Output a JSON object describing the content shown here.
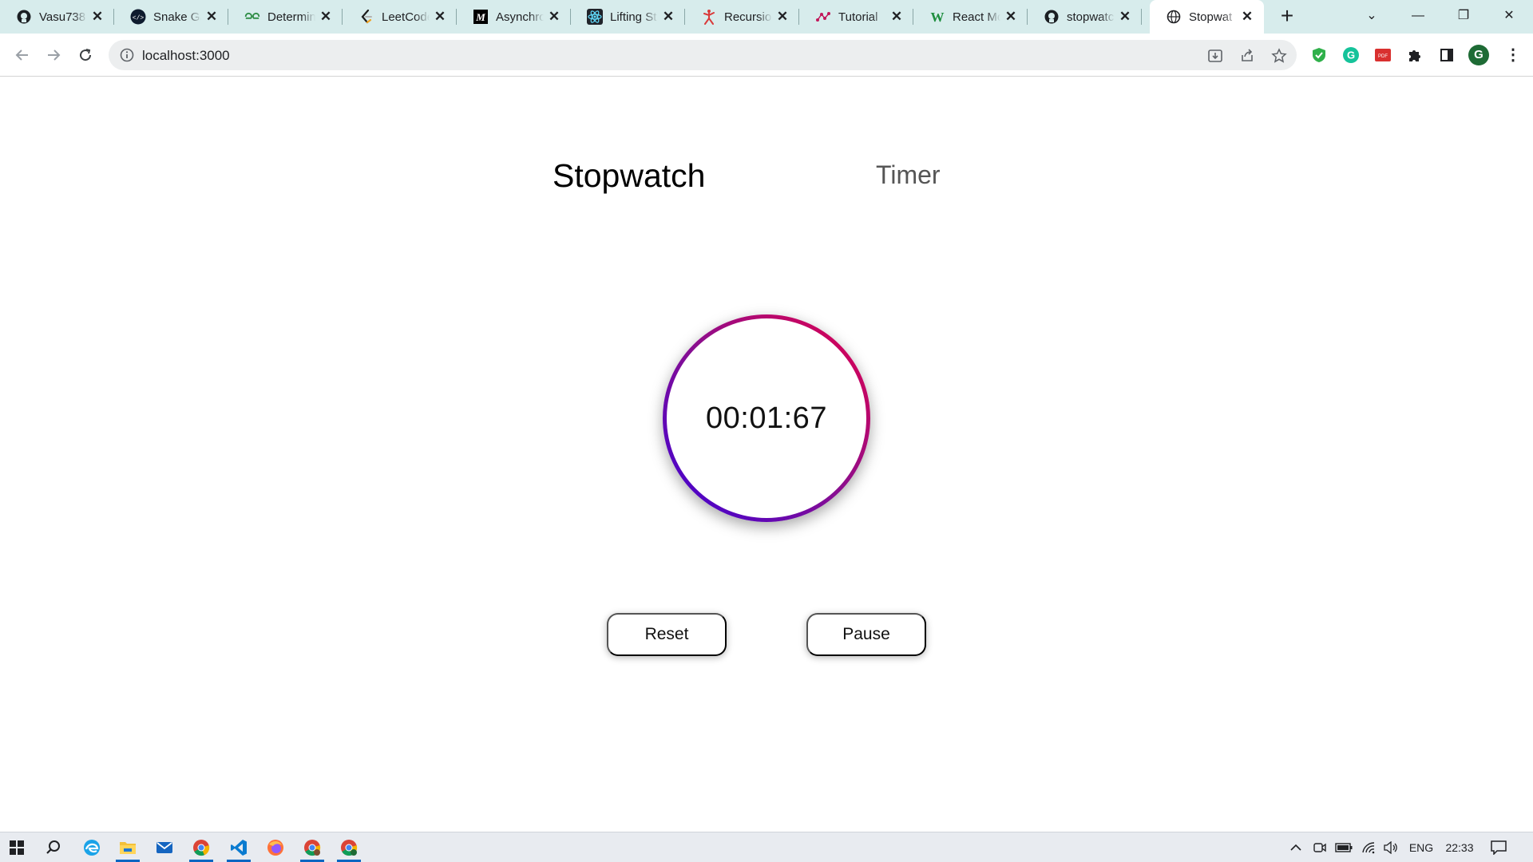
{
  "browser": {
    "tabs": [
      {
        "title": "Vasu738",
        "icon": "github-icon"
      },
      {
        "title": "Snake Ga",
        "icon": "code-icon"
      },
      {
        "title": "Determin",
        "icon": "geeksforgeeks-icon"
      },
      {
        "title": "LeetCode",
        "icon": "leetcode-icon"
      },
      {
        "title": "Asynchro",
        "icon": "medium-icon"
      },
      {
        "title": "Lifting St",
        "icon": "react-icon"
      },
      {
        "title": "Recursio",
        "icon": "person-icon"
      },
      {
        "title": "Tutorial",
        "icon": "dots-icon"
      },
      {
        "title": "React Mo",
        "icon": "w-icon"
      },
      {
        "title": "stopwatc",
        "icon": "github-icon"
      },
      {
        "title": "Stopwat",
        "icon": "globe-icon",
        "active": true
      }
    ],
    "address": "localhost:3000"
  },
  "app": {
    "modes": {
      "stopwatch": "Stopwatch",
      "timer": "Timer"
    },
    "display": "00:01:67",
    "ring_gradient": [
      "#e5004b",
      "#8a0e8f",
      "#3a00d8"
    ],
    "buttons": {
      "reset": "Reset",
      "pause": "Pause"
    }
  },
  "taskbar": {
    "apps": [
      "windows-start-icon",
      "search-icon",
      "edge-icon",
      "file-explorer-icon",
      "mail-icon",
      "chrome-icon",
      "vscode-icon",
      "firefox-icon",
      "chrome-profile-icon",
      "chrome-profile-icon"
    ],
    "language": "ENG",
    "clock": "22:33"
  }
}
